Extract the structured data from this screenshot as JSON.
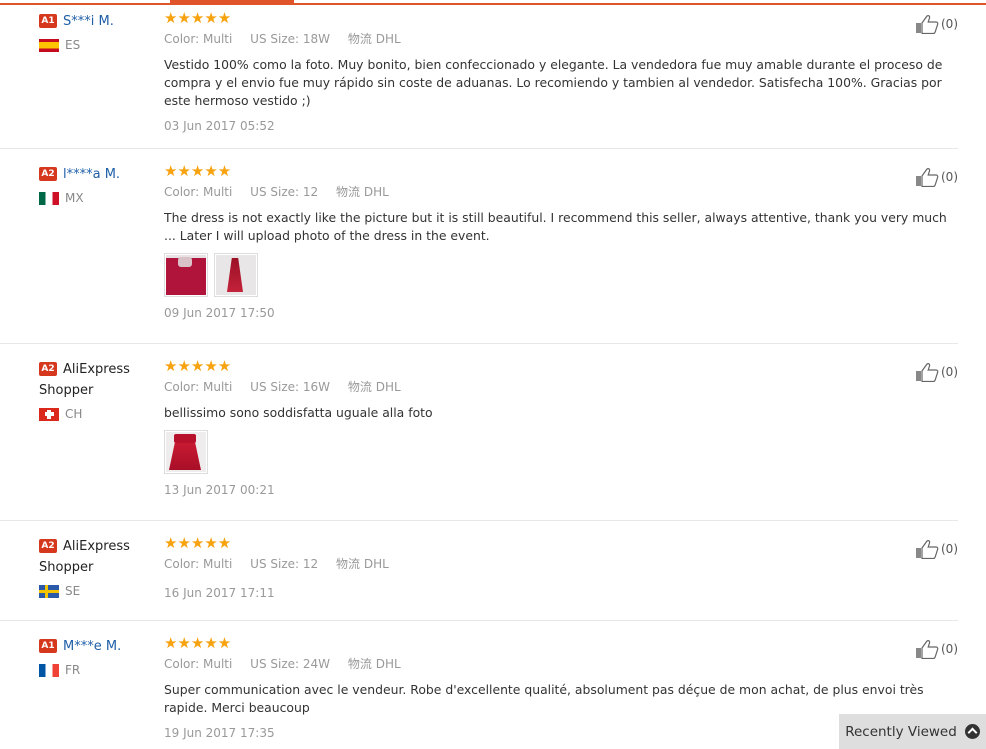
{
  "recently_viewed": {
    "label": "Recently Viewed"
  },
  "attr_labels": {
    "color": "Color:",
    "size": "US Size:",
    "ship": "物流"
  },
  "reviews": [
    {
      "badge": "A1",
      "name": "S***i M.",
      "country": "ES",
      "stars": "★★★★★",
      "color": "Multi",
      "size": "18W",
      "ship": "DHL",
      "text": "Vestido 100% como la foto. Muy bonito, bien confeccionado y elegante. La vendedora fue muy amable durante el proceso de compra y el envio fue muy rápido sin coste de aduanas. Lo recomiendo y tambien al vendedor. Satisfecha 100%. Gracias por este hermoso vestido ;)",
      "date": "03 Jun 2017 05:52",
      "useful": "(0)"
    },
    {
      "badge": "A2",
      "name": "l****a M.",
      "country": "MX",
      "stars": "★★★★★",
      "color": "Multi",
      "size": "12",
      "ship": "DHL",
      "text": "The dress is not exactly like the picture but it is still beautiful. I recommend this seller, always attentive, thank you very much ... Later I will upload photo of the dress in the event.",
      "date": "09 Jun 2017 17:50",
      "useful": "(0)"
    },
    {
      "badge": "A2",
      "name": "AliExpress Shopper",
      "country": "CH",
      "stars": "★★★★★",
      "color": "Multi",
      "size": "16W",
      "ship": "DHL",
      "text": "bellissimo sono soddisfatta uguale alla foto",
      "date": "13 Jun 2017 00:21",
      "useful": "(0)"
    },
    {
      "badge": "A2",
      "name": "AliExpress Shopper",
      "country": "SE",
      "stars": "★★★★★",
      "color": "Multi",
      "size": "12",
      "ship": "DHL",
      "text": "",
      "date": "16 Jun 2017 17:11",
      "useful": "(0)"
    },
    {
      "badge": "A1",
      "name": "M***e M.",
      "country": "FR",
      "stars": "★★★★★",
      "color": "Multi",
      "size": "24W",
      "ship": "DHL",
      "text": "Super communication avec le vendeur. Robe d'excellente qualité, absolument pas déçue de mon achat, de plus envoi très rapide. Merci beaucoup",
      "date": "19 Jun 2017 17:35",
      "useful": "(0)"
    }
  ]
}
